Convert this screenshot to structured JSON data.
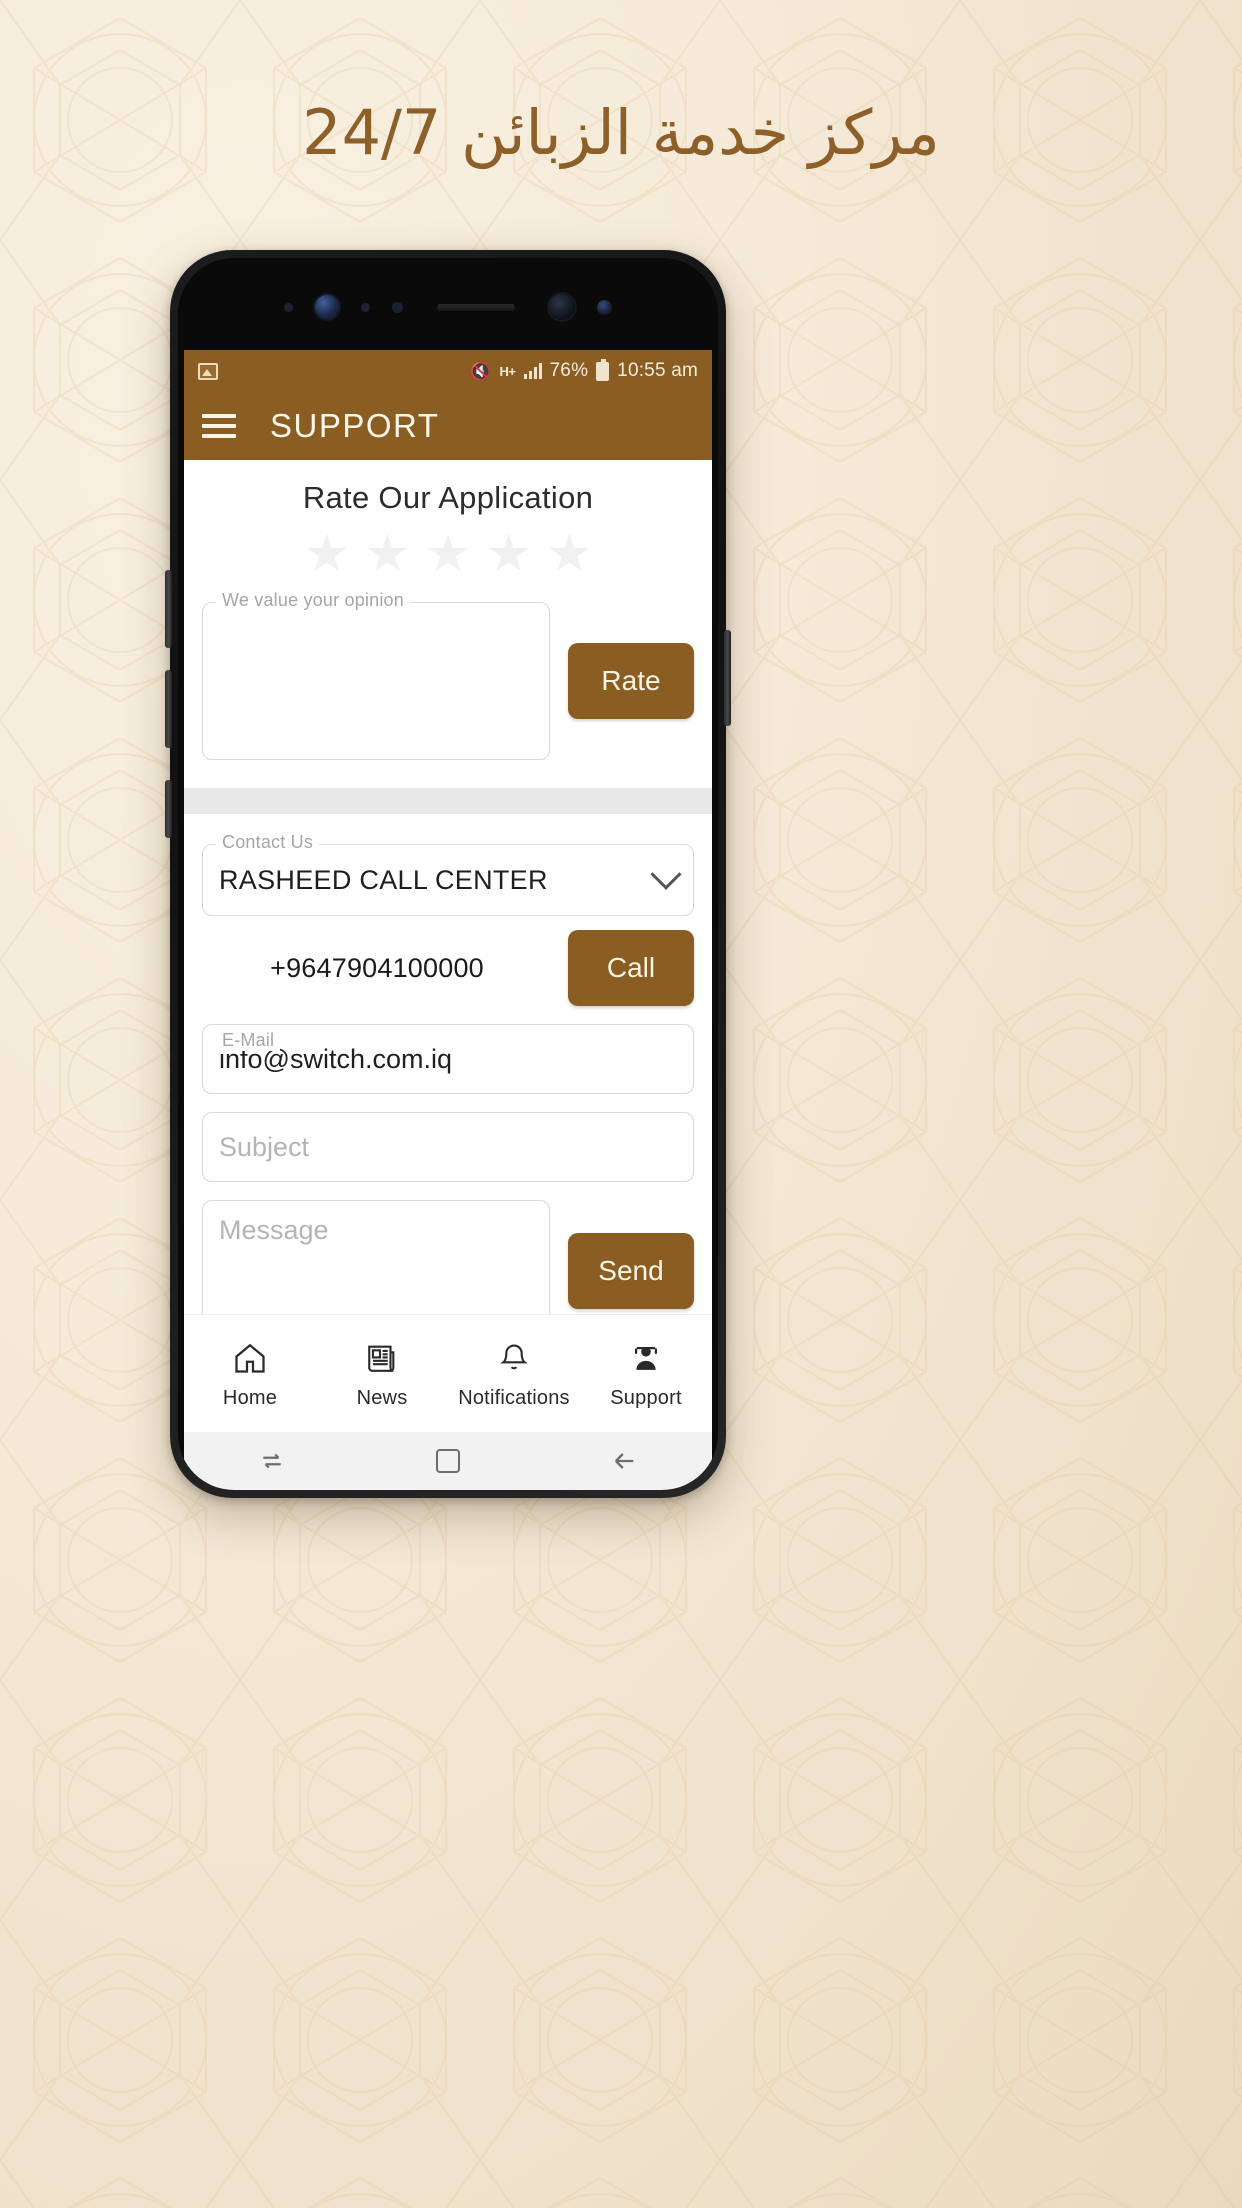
{
  "headline": "مركز خدمة الزبائن  24/7",
  "colors": {
    "brand": "#8a5e22",
    "background": "#f3e7d3",
    "app_bar_text": "#fdf6e8"
  },
  "status_bar": {
    "photo_icon": "photo-icon",
    "mute_icon": "🔇",
    "network_type": "H+",
    "battery_percent": "76%",
    "time": "10:55 am"
  },
  "app_bar": {
    "menu_icon": "hamburger-icon",
    "title": "SUPPORT"
  },
  "rating": {
    "title": "Rate Our Application",
    "stars": [
      "★",
      "★",
      "★",
      "★",
      "★"
    ],
    "stars_filled": 0,
    "opinion_label": "We value your opinion",
    "opinion_value": "",
    "opinion_placeholder": "",
    "rate_button": "Rate"
  },
  "contact": {
    "select_label": "Contact Us",
    "select_value": "RASHEED CALL CENTER",
    "select_options": [
      "RASHEED CALL CENTER"
    ],
    "phone_number": "+9647904100000",
    "call_button": "Call",
    "email_label": "E-Mail",
    "email_value": "info@switch.com.iq",
    "subject_placeholder": "Subject",
    "subject_value": "",
    "message_placeholder": "Message",
    "message_value": "",
    "send_button": "Send"
  },
  "bottom_nav": [
    {
      "label": "Home",
      "icon": "home-icon"
    },
    {
      "label": "News",
      "icon": "newspaper-icon"
    },
    {
      "label": "Notifications",
      "icon": "bell-icon"
    },
    {
      "label": "Support",
      "icon": "headset-agent-icon"
    }
  ],
  "android_keys": {
    "recents": "recents-icon",
    "home": "home-square-icon",
    "back": "back-arrow-icon"
  }
}
